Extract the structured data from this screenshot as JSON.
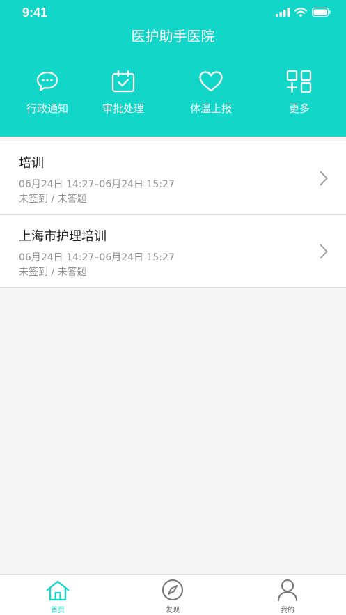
{
  "status_bar": {
    "time": "9:41"
  },
  "header": {
    "title": "医护助手医院"
  },
  "quick_actions": [
    {
      "label": "行政通知",
      "icon": "chat-bubble-icon"
    },
    {
      "label": "审批处理",
      "icon": "calendar-check-icon"
    },
    {
      "label": "体温上报",
      "icon": "heart-icon"
    },
    {
      "label": "更多",
      "icon": "grid-plus-icon"
    }
  ],
  "trainings": [
    {
      "title": "培训",
      "time": "06月24日 14:27–06月24日 15:27",
      "status": "未签到 / 未答题"
    },
    {
      "title": "上海市护理培训",
      "time": "06月24日 14:27–06月24日 15:27",
      "status": "未签到 / 未答题"
    }
  ],
  "tabbar": [
    {
      "label": "首页",
      "icon": "home-icon",
      "active": true
    },
    {
      "label": "发现",
      "icon": "compass-icon",
      "active": false
    },
    {
      "label": "我的",
      "icon": "user-icon",
      "active": false
    }
  ],
  "colors": {
    "accent": "#12d6c7",
    "text_secondary": "#8e8e8e"
  }
}
